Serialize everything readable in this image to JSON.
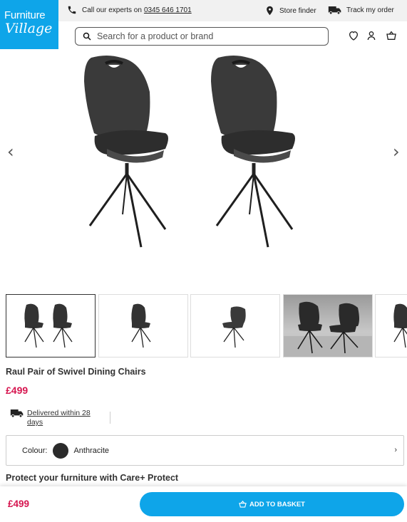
{
  "logo": {
    "line1": "Furniture",
    "line2": "Village"
  },
  "topbar": {
    "call_text": "Call our experts on",
    "phone_number": "0345 646 1701",
    "store_finder": "Store finder",
    "track_order": "Track my order"
  },
  "search": {
    "placeholder": "Search for a product or brand"
  },
  "gallery": {
    "prev_arrow": "‹",
    "next_arrow": "›",
    "thumbnail_count": 5,
    "active_thumbnail": 1
  },
  "product": {
    "title": "Raul Pair of Swivel Dining Chairs",
    "price": "£499",
    "delivery": "Delivered within 28 days",
    "colour_label": "Colour:",
    "colour_name": "Anthracite",
    "colour_hex": "#2b2b2b",
    "chevron": "›"
  },
  "protect": {
    "heading": "Protect your furniture with Care+ Protect"
  },
  "sticky": {
    "price": "£499",
    "add_to_basket": "ADD TO BASKET"
  },
  "colors": {
    "brand": "#0ea5e9",
    "price": "#d6154f"
  }
}
